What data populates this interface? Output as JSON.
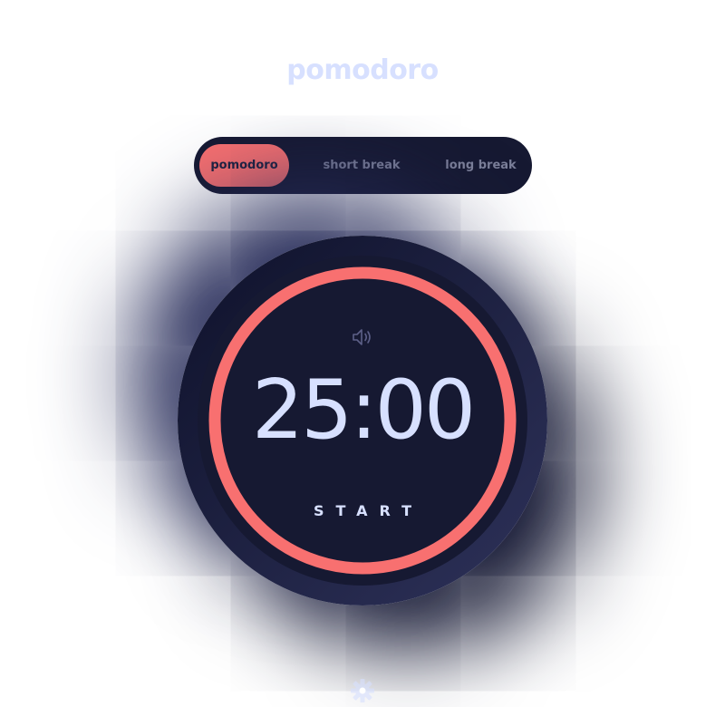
{
  "app": {
    "title": "pomodoro"
  },
  "modes": {
    "items": [
      {
        "label": "pomodoro",
        "active": true
      },
      {
        "label": "short break",
        "active": false
      },
      {
        "label": "long break",
        "active": false
      }
    ]
  },
  "timer": {
    "time": "25:00",
    "action_label": "START",
    "progress": 1.0,
    "sound_icon": "speaker-volume-icon"
  },
  "footer": {
    "settings_icon": "gear-icon"
  },
  "colors": {
    "accent": "#f87070",
    "text_light": "#d7e0ff",
    "dark_bg": "#161932",
    "tab_inactive": "#7b7f99"
  }
}
